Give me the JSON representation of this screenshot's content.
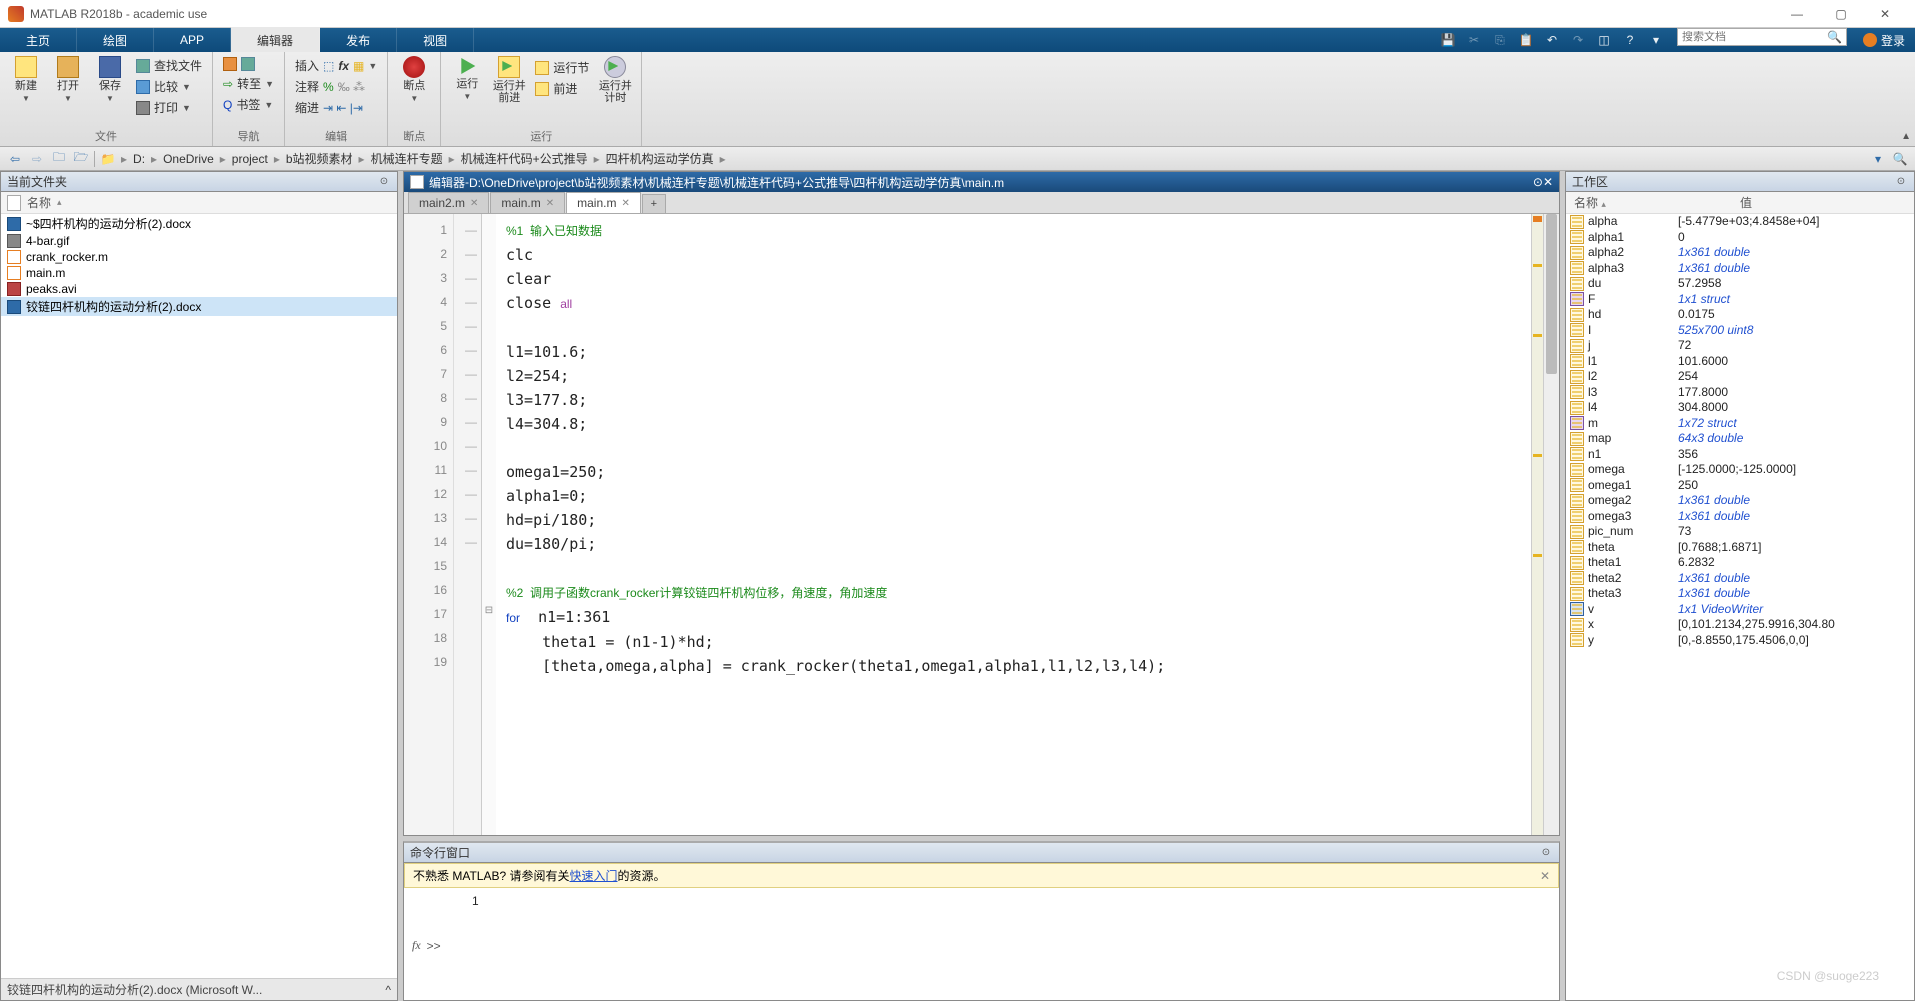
{
  "window": {
    "title": "MATLAB R2018b - academic use"
  },
  "tabs": {
    "home": "主页",
    "plot": "绘图",
    "app": "APP",
    "editor": "编辑器",
    "publish": "发布",
    "view": "视图",
    "login": "登录"
  },
  "search": {
    "placeholder": "搜索文档"
  },
  "toolstrip": {
    "file": {
      "new": "新建",
      "open": "打开",
      "save": "保存",
      "findfiles": "查找文件",
      "compare": "比较",
      "print": "打印",
      "label": "文件"
    },
    "nav": {
      "go": "转至",
      "bookmark": "书签",
      "label": "导航"
    },
    "edit": {
      "insert": "插入",
      "comment": "注释",
      "indent": "缩进",
      "label": "编辑"
    },
    "bp": {
      "breakpoint": "断点",
      "label": "断点"
    },
    "run": {
      "run": "运行",
      "runadvance": "运行并\n前进",
      "runsection": "运行节",
      "advance": "前进",
      "runtime": "运行并\n计时",
      "label": "运行"
    }
  },
  "breadcrumbs": [
    "D:",
    "OneDrive",
    "project",
    "b站视频素材",
    "机械连杆专题",
    "机械连杆代码+公式推导",
    "四杆机构运动学仿真"
  ],
  "panels": {
    "currentFolder": "当前文件夹",
    "editor": "编辑器",
    "workspace": "工作区",
    "command": "命令行窗口"
  },
  "folderHdr": {
    "name": "名称"
  },
  "files": [
    {
      "name": "~$四杆机构的运动分析(2).docx",
      "type": "docx"
    },
    {
      "name": "4-bar.gif",
      "type": "gif"
    },
    {
      "name": "crank_rocker.m",
      "type": "m"
    },
    {
      "name": "main.m",
      "type": "m"
    },
    {
      "name": "peaks.avi",
      "type": "avi"
    },
    {
      "name": "铰链四杆机构的运动分析(2).docx",
      "type": "docx",
      "selected": true
    }
  ],
  "statusbar": "铰链四杆机构的运动分析(2).docx  (Microsoft W...",
  "editorPath": "D:\\OneDrive\\project\\b站视频素材\\机械连杆专题\\机械连杆代码+公式推导\\四杆机构运动学仿真\\main.m",
  "editorTabs": [
    {
      "name": "main2.m"
    },
    {
      "name": "main.m"
    },
    {
      "name": "main.m",
      "active": true
    }
  ],
  "code": {
    "l1": "%1  输入已知数据",
    "l2": "clc",
    "l3": "clear",
    "l4a": "close ",
    "l4b": "all",
    "l6": "l1=101.6;",
    "l7": "l2=254;",
    "l8": "l3=177.8;",
    "l9": "l4=304.8;",
    "l11": "omega1=250;",
    "l12": "alpha1=0;",
    "l13": "hd=pi/180;",
    "l14": "du=180/pi;",
    "l16": "%2  调用子函数crank_rocker计算铰链四杆机构位移，角速度，角加速度",
    "l17a": "for",
    "l17b": "  n1=1:361",
    "l18": "    theta1 = (n1-1)*hd;",
    "l19": "    [theta,omega,alpha] = crank_rocker(theta1,omega1,alpha1,l1,l2,l3,l4);"
  },
  "cmd": {
    "bannerA": "不熟悉 MATLAB? 请参阅有关",
    "bannerLink": "快速入门",
    "bannerB": "的资源。",
    "history": "1"
  },
  "wsHdr": {
    "name": "名称",
    "value": "值"
  },
  "vars": [
    {
      "n": "alpha",
      "v": "[-5.4779e+03;4.8458e+04]"
    },
    {
      "n": "alpha1",
      "v": "0"
    },
    {
      "n": "alpha2",
      "v": "1x361 double",
      "link": true
    },
    {
      "n": "alpha3",
      "v": "1x361 double",
      "link": true
    },
    {
      "n": "du",
      "v": "57.2958"
    },
    {
      "n": "F",
      "v": "1x1 struct",
      "link": true,
      "struct": true
    },
    {
      "n": "hd",
      "v": "0.0175"
    },
    {
      "n": "I",
      "v": "525x700 uint8",
      "link": true
    },
    {
      "n": "j",
      "v": "72"
    },
    {
      "n": "l1",
      "v": "101.6000"
    },
    {
      "n": "l2",
      "v": "254"
    },
    {
      "n": "l3",
      "v": "177.8000"
    },
    {
      "n": "l4",
      "v": "304.8000"
    },
    {
      "n": "m",
      "v": "1x72 struct",
      "link": true,
      "struct": true
    },
    {
      "n": "map",
      "v": "64x3 double",
      "link": true
    },
    {
      "n": "n1",
      "v": "356"
    },
    {
      "n": "omega",
      "v": "[-125.0000;-125.0000]"
    },
    {
      "n": "omega1",
      "v": "250"
    },
    {
      "n": "omega2",
      "v": "1x361 double",
      "link": true
    },
    {
      "n": "omega3",
      "v": "1x361 double",
      "link": true
    },
    {
      "n": "pic_num",
      "v": "73"
    },
    {
      "n": "theta",
      "v": "[0.7688;1.6871]"
    },
    {
      "n": "theta1",
      "v": "6.2832"
    },
    {
      "n": "theta2",
      "v": "1x361 double",
      "link": true
    },
    {
      "n": "theta3",
      "v": "1x361 double",
      "link": true
    },
    {
      "n": "v",
      "v": "1x1 VideoWriter",
      "link": true,
      "obj": true
    },
    {
      "n": "x",
      "v": "[0,101.2134,275.9916,304.80"
    },
    {
      "n": "y",
      "v": "[0,-8.8550,175.4506,0,0]"
    }
  ],
  "watermark": "CSDN @suoge223"
}
